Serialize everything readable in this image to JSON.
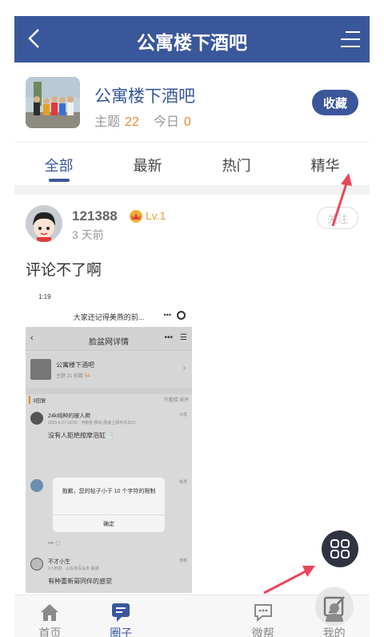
{
  "header": {
    "title": "公寓楼下酒吧",
    "back_icon": "back-arrow-icon",
    "menu_icon": "menu-icon",
    "background": "#3b579b"
  },
  "forum": {
    "name": "公寓楼下酒吧",
    "topics_label": "主题",
    "topics_count": "22",
    "today_label": "今日",
    "today_count": "0",
    "favorite_label": "收藏"
  },
  "tabs": [
    {
      "label": "全部",
      "active": true
    },
    {
      "label": "最新",
      "active": false
    },
    {
      "label": "热门",
      "active": false
    },
    {
      "label": "精华",
      "active": false
    }
  ],
  "post": {
    "username": "121388",
    "level": "Lv.1",
    "time": "3 天前",
    "follow_label": "关注",
    "text": "评论不了啊"
  },
  "embedded_screenshot": {
    "status_time": "1:19",
    "nav_title": "大家还记得美燕的前...",
    "nav_dots": "•••",
    "page_title": "脸盆网详情",
    "page_dots": "•••",
    "forum_name": "公寓楼下酒吧",
    "forum_stats_prefix": "主题 21  帖数 ",
    "forum_stats_num": "54",
    "replies_header": "3回复",
    "sort_label": "只看楼  排序",
    "comments": [
      {
        "name": "24k纯种的被人欺",
        "meta": "2025-6-27 18:50 · 河南省 移动·限速上网示共出口",
        "floor": "沙发",
        "text": "没有人拒绝按摩浴缸🛁"
      },
      {
        "name": "",
        "meta": "",
        "floor": "板凳",
        "text": ""
      },
      {
        "name": "不才小生",
        "meta": "1小时前 · 山东省青岛市 联通",
        "floor": "地板",
        "text": "有种重新哥同伴的感觉"
      }
    ],
    "dialog_message": "抱歉，您的帖子小于 10 个字符的限制",
    "dialog_confirm": "确定"
  },
  "bottom_nav": [
    {
      "label": "首页",
      "icon": "home-icon",
      "active": false
    },
    {
      "label": "圈子",
      "icon": "circle-chat-icon",
      "active": true
    },
    {
      "label": "",
      "icon": "compose-icon",
      "active": false
    },
    {
      "label": "微帮",
      "icon": "help-chat-icon",
      "active": false
    },
    {
      "label": "我的",
      "icon": "profile-icon",
      "active": false
    }
  ],
  "colors": {
    "accent": "#3b579b",
    "count": "#e8873a",
    "arrow": "#e8475a"
  }
}
